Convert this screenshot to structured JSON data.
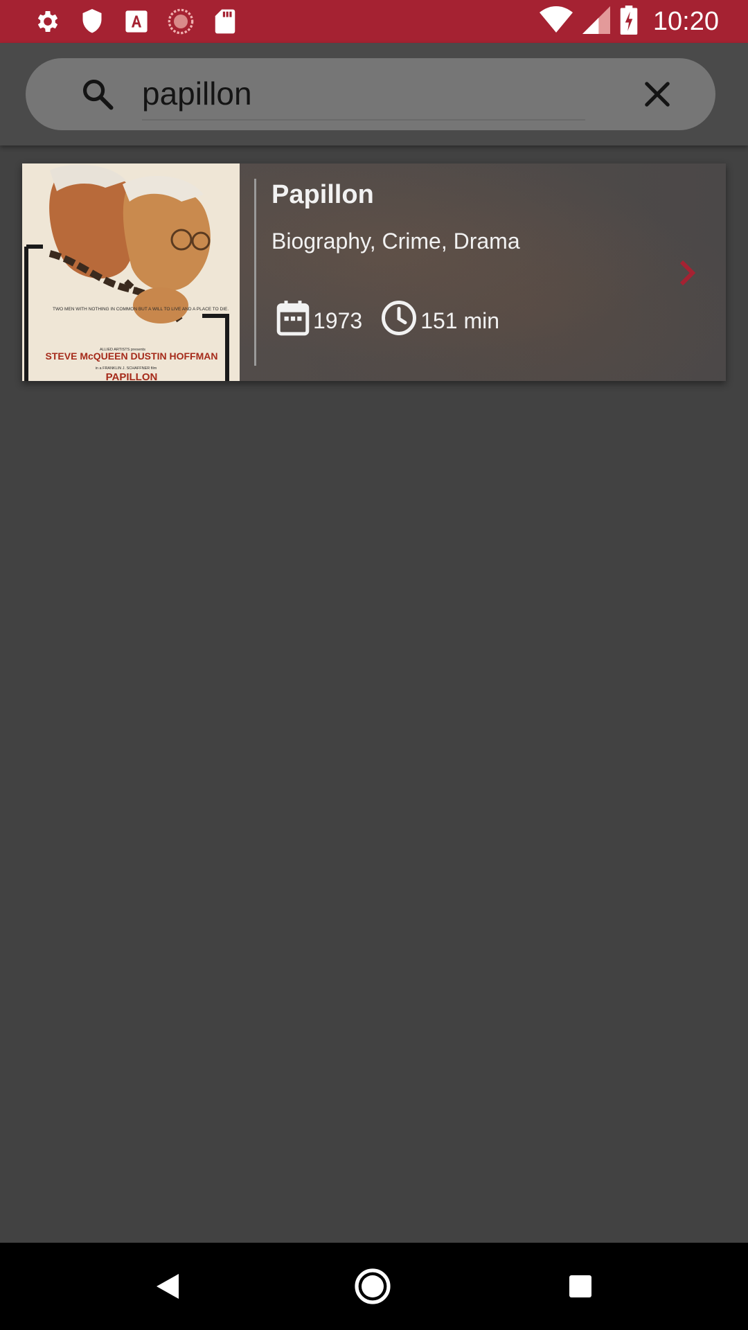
{
  "status_bar": {
    "time": "10:20",
    "icons": [
      "settings-icon",
      "shield-icon",
      "font-a-icon",
      "sync-circle-icon",
      "sd-card-icon",
      "wifi-icon",
      "signal-icon",
      "battery-charging-icon"
    ],
    "color": "#a52232"
  },
  "search": {
    "value": "papillon",
    "placeholder": ""
  },
  "results": [
    {
      "title": "Papillon",
      "genres": "Biography, Crime, Drama",
      "year": "1973",
      "runtime": "151 min",
      "poster": {
        "tagline": "TWO MEN WITH NOTHING IN COMMON BUT A WILL TO LIVE AND A PLACE TO DIE.",
        "credit_small": "ALLIED ARTISTS presents",
        "stars": "STEVE McQUEEN DUSTIN HOFFMAN",
        "producer_line": "in a FRANKLIN J. SCHAFFNER film",
        "title": "PAPILLON"
      }
    }
  ],
  "colors": {
    "accent": "#a52232",
    "background": "#424242"
  },
  "nav": {
    "buttons": [
      "back-icon",
      "home-icon",
      "recents-icon"
    ]
  }
}
